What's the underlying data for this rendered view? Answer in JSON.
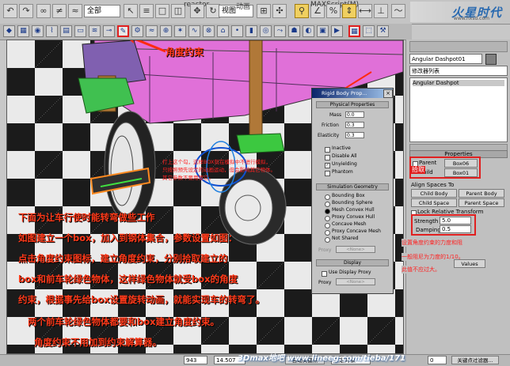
{
  "top_toolbar": {
    "selection_filter": "全部",
    "view_combo": "视图",
    "menu_reactor": "reactor",
    "menu_animation": "动画",
    "menu_maxscript": "MAXScript(M)"
  },
  "logo": {
    "text": "火星时代",
    "sub": "www.hxsd.com"
  },
  "annotations": {
    "angle_constraint_label": "角度约束",
    "box_note_line1": "打上这个勾，这样BOX就在模拟中不进行模拟，",
    "box_note_line2": "只按照预先设定的动画运动，但会影响其它物体。",
    "box_note_line3": "其它参数不要用管它。",
    "pick_label": "拾取",
    "strength_note_line1": "设置角度约束的力度和阻",
    "strength_note_line2": "一般阻尼为力度的1/10。",
    "strength_note_line3": "此值不应过大。",
    "body": [
      "下面为让车行使时能转弯做些工作",
      "如图建立一个box，加入到钢体集合，参数设置如图：",
      "点击角度约束图标，建立角度约束，分别拾取建立的",
      "box和前车轮绿色物体，这样绿色物体就受box的角度",
      "约束，根据事先给box设置旋转动画，就能实现车的转弯了。",
      "两个前车轮绿色物体都要和box建立角度约束。",
      "角度约束不用加到约束解算器。"
    ]
  },
  "dialog": {
    "title": "Rigid Body Prop...",
    "physical_properties": "Physical Properties",
    "mass_label": "Mass",
    "mass_value": "0.0",
    "friction_label": "Friction",
    "friction_value": "0.3",
    "elasticity_label": "Elasticity",
    "elasticity_value": "0.3",
    "checks": [
      "Inactive",
      "Disable All",
      "Unyielding",
      "Phantom"
    ],
    "simulation_geometry": "Simulation Geometry",
    "geometry_options": [
      "Bounding Box",
      "Bounding Sphere",
      "Mesh Convex Hull",
      "Proxy Convex Hull",
      "Concave Mesh",
      "Proxy Concave Mesh",
      "Not Shared"
    ],
    "proxy_label": "Proxy",
    "none_button": "<None>",
    "display": "Display",
    "use_display_proxy": "Use Display Proxy"
  },
  "command_panel": {
    "object_name": "Angular Dashpot01",
    "modifier_list": "修改器列表",
    "stack_item": "Angular Dashpot",
    "properties_rollout": "Properties",
    "parent_label": "Parent",
    "parent_value": "Box06",
    "child_label": "Child",
    "child_value": "Box01",
    "align_spaces_to": "Align Spaces To",
    "child_body": "Child Body",
    "parent_body": "Parent Body",
    "child_space": "Child Space",
    "parent_space": "Parent Space",
    "lock_relative": "Lock Relative Transform",
    "strength_label": "Strength",
    "strength_value": "5.0",
    "damping_label": "Damping",
    "damping_value": "0.5",
    "values_button": "Values"
  },
  "status_bar": {
    "y_value": "943",
    "z_value": "14.507",
    "auto_key": "自动关键点",
    "selected": "选定对象",
    "frame_value": "0",
    "key_filters": "关键点过滤器..."
  },
  "watermark": "3Dmax地吧  www.lineeg.com/tieba/171",
  "colors": {
    "annotation": "#ff3a1a",
    "highlight_box": "#e02020",
    "title_bar": "#0a246a"
  }
}
